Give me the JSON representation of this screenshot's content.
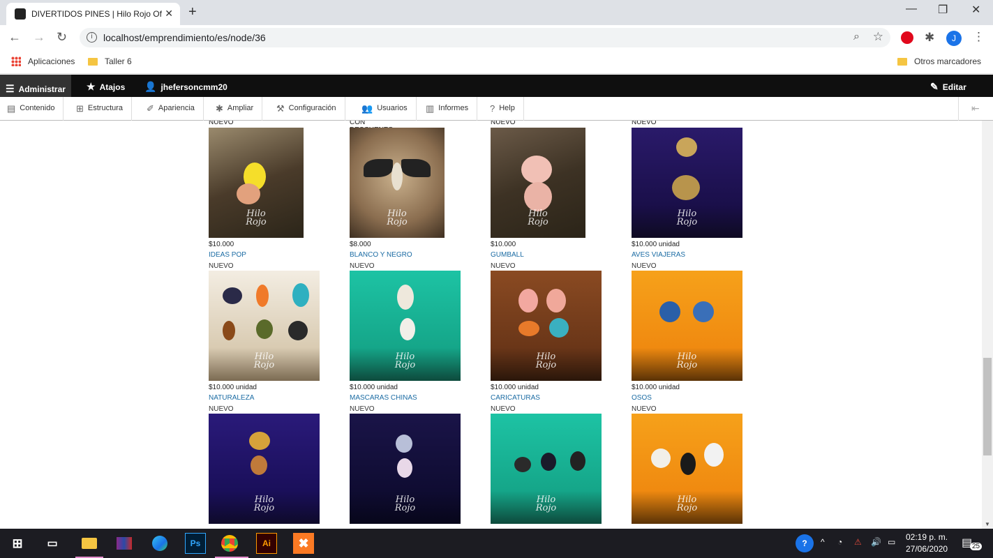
{
  "browser": {
    "tab_title": "DIVERTIDOS PINES | Hilo Rojo Of",
    "url": "localhost/emprendimiento/es/node/36",
    "profile_initial": "J",
    "bookmarks": {
      "apps": "Aplicaciones",
      "folder1": "Taller 6",
      "other": "Otros marcadores"
    }
  },
  "admin_toolbar": {
    "manage": "Administrar",
    "shortcuts": "Atajos",
    "user": "jhefersoncmm20",
    "edit": "Editar",
    "tray": [
      "Contenido",
      "Estructura",
      "Apariencia",
      "Ampliar",
      "Configuración",
      "Usuarios",
      "Informes",
      "Help"
    ]
  },
  "products": {
    "top_tags": [
      "NUEVO",
      "CON DESCUENTO",
      "NUEVO",
      "NUEVO"
    ],
    "row1": [
      {
        "price": "$10.000",
        "name": "IDEAS POP",
        "tag": "NUEVO"
      },
      {
        "price": "$8.000",
        "name": "BLANCO Y NEGRO",
        "tag": "NUEVO"
      },
      {
        "price": "$10.000",
        "name": "GUMBALL",
        "tag": "NUEVO"
      },
      {
        "price": "$10.000 unidad",
        "name": "AVES VIAJERAS",
        "tag": "NUEVO"
      }
    ],
    "row2": [
      {
        "price": "$10.000 unidad",
        "name": "NATURALEZA",
        "tag": "NUEVO"
      },
      {
        "price": "$10.000 unidad",
        "name": "MASCARAS CHINAS",
        "tag": "NUEVO"
      },
      {
        "price": "$10.000 unidad",
        "name": "CARICATURAS",
        "tag": "NUEVO"
      },
      {
        "price": "$10.000 unidad",
        "name": "OSOS",
        "tag": "NUEVO"
      }
    ],
    "watermark_line1": "Hilo",
    "watermark_line2": "Rojo"
  },
  "taskbar": {
    "time": "02:19 p. m.",
    "date": "27/06/2020",
    "notifications": "25",
    "ps": "Ps",
    "ai": "Ai"
  }
}
